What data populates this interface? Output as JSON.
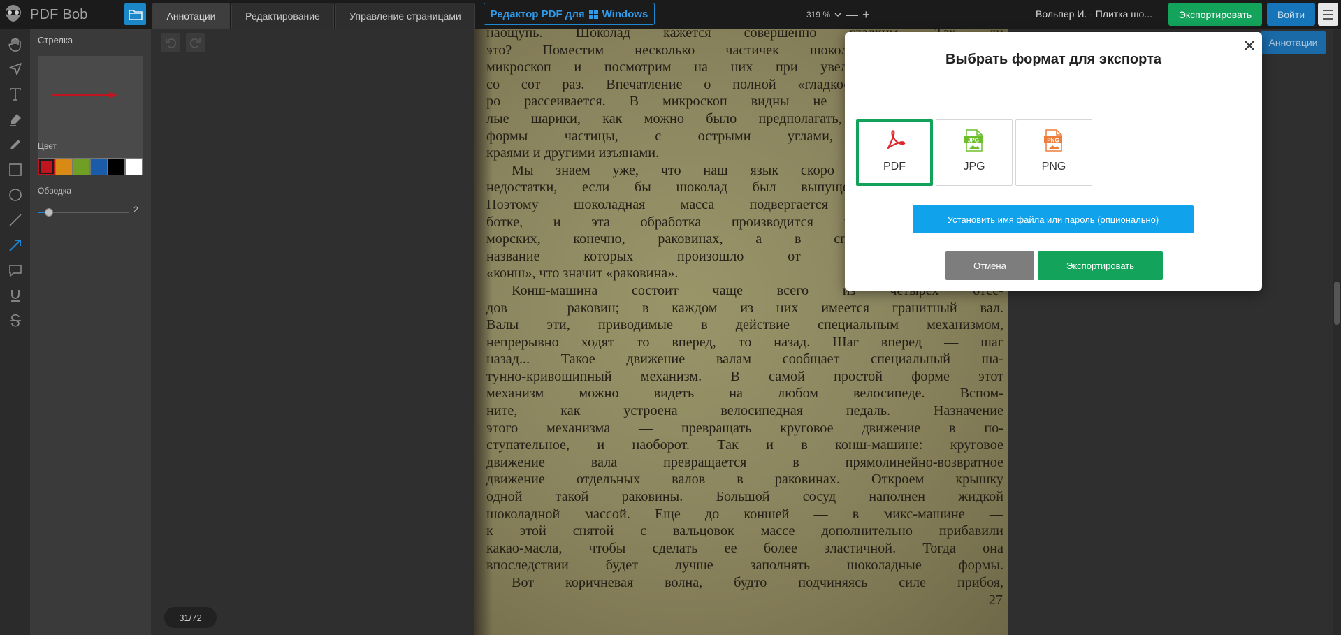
{
  "app": {
    "name": "PDF Bob"
  },
  "tabs": [
    {
      "label": "Аннотации",
      "active": true
    },
    {
      "label": "Редактирование",
      "active": false
    },
    {
      "label": "Управление страницами",
      "active": false
    }
  ],
  "windows_button": {
    "label_prefix": "Редактор PDF для",
    "label_suffix": "Windows"
  },
  "zoom": {
    "value": "319 %",
    "minus": "—",
    "plus": "+"
  },
  "document": {
    "title": "Вольпер И. - Плитка шо..."
  },
  "header_buttons": {
    "export": "Экспортировать",
    "login": "Войти"
  },
  "properties": {
    "tool_name": "Стрелка",
    "color_label": "Цвет",
    "stroke_label": "Обводка",
    "stroke_value": "2",
    "stroke_fraction": 0.12,
    "colors": [
      "#c0151f",
      "#d98a14",
      "#6f9f25",
      "#1a5ca8",
      "#000000",
      "#ffffff"
    ],
    "selected_color": "#c0151f"
  },
  "viewer": {
    "page_counter": "31/72",
    "annotations_pill": "Аннотации"
  },
  "page_text": {
    "lines": [
      "наощупь. Шоколад кажется совершенно гладким. Так ли",
      "это? Поместим несколько частичек шоколадной массы под",
      "микроскоп и посмотрим на них при увеличении в несколько",
      "со сот раз. Впечатление о полной «гладкости» шоколада сразу",
      "ро рассеивается. В микроскоп видны не правильные шаровид-",
      "лые шарики, как можно было предполагать, а частицы непра-",
      "формы частицы, с острыми углами, зазубринками по",
      "краями и другими изъянами.",
      "Мы знаем уже, что наш язык скоро обнаружил бы эти",
      "недостатки, если бы шоколад был выпущен в таком виде.",
      "Поэтому шоколадная масса подвергается дальнейшей обра-",
      "ботке, и эта обработка производится в... раковинах. Не",
      "морских, конечно, раковинах, а в специальных машинах,",
      "название которых произошло от французского слова",
      "«конш», что значит «раковина».",
      "Конш-машина состоит чаще всего из четырех отсе-",
      "дов — раковин; в каждом из них имеется гранитный вал.",
      "Валы эти, приводимые в действие специальным механизмом,",
      "непрерывно ходят то вперед, то назад. Шаг вперед — шаг",
      "назад... Такое движение валам сообщает специальный ша-",
      "тунно-кривошипный механизм. В самой простой форме этот",
      "механизм можно видеть на любом велосипеде. Вспом-",
      "ните, как устроена велосипедная педаль. Назначение",
      "этого механизма — превращать круговое движение в по-",
      "ступательное, и наоборот. Так и в конш-машине: круговое",
      "движение вала превращается в прямолинейно-возвратное",
      "движение отдельных валов в раковинах. Откроем крышку",
      "одной такой раковины. Большой сосуд наполнен жидкой",
      "шоколадной массой. Еще до коншей — в микс-машине —",
      "к этой снятой с вальцовок массе дополнительно прибавили",
      "какао-масла, чтобы сделать ее более эластичной. Тогда она",
      "впоследствии будет лучше заполнять шоколадные формы.",
      "Вот коричневая волна, будто подчиняясь силе прибоя,"
    ],
    "page_number": "27"
  },
  "modal": {
    "title": "Выбрать формат для экспорта",
    "formats": [
      {
        "label": "PDF",
        "icon": "pdf-icon",
        "selected": true
      },
      {
        "label": "JPG",
        "icon": "jpg-file-icon",
        "selected": false
      },
      {
        "label": "PNG",
        "icon": "png-file-icon",
        "selected": false
      }
    ],
    "set_filename_button": "Установить имя файла или пароль (опционально)",
    "cancel_button": "Отмена",
    "export_button": "Экспортировать"
  },
  "colors": {
    "accent_green": "#13a35b",
    "accent_blue": "#10a2ea",
    "pdf_red": "#e0262a",
    "jpg_green": "#6cbf2b",
    "png_orange": "#ee7d3a"
  }
}
